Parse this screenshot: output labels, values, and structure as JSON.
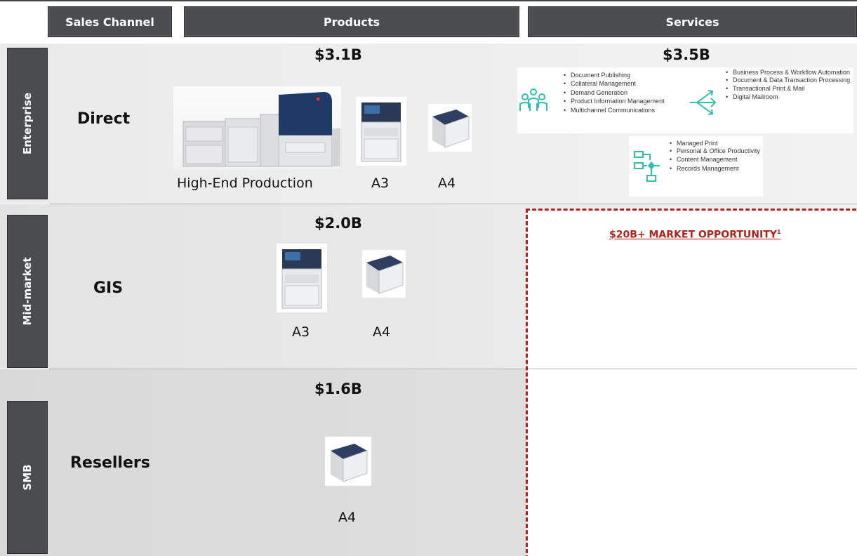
{
  "columns": {
    "sales_channel": "Sales Channel",
    "products": "Products",
    "services": "Services"
  },
  "segments": {
    "enterprise": "Enterprise",
    "mid_market": "Mid-market",
    "smb": "SMB"
  },
  "rows": {
    "enterprise": {
      "channel": "Direct",
      "products_amount": "$3.1B",
      "services_amount": "$3.5B",
      "product_labels": [
        "High-End Production",
        "A3",
        "A4"
      ]
    },
    "mid_market": {
      "channel": "GIS",
      "products_amount": "$2.0B",
      "product_labels": [
        "A3",
        "A4"
      ]
    },
    "smb": {
      "channel": "Resellers",
      "products_amount": "$1.6B",
      "product_labels": [
        "A4"
      ]
    }
  },
  "services": {
    "group1": [
      "Document Publishing",
      "Collateral Management",
      "Demand Generation",
      "Product Information Management",
      "Multichannel Communications"
    ],
    "group2": [
      "Business Process & Workflow Automation",
      "Document & Data Transaction Processing",
      "Transactional Print & Mail",
      "Digital Mailroom"
    ],
    "group3": [
      "Managed Print",
      "Personal & Office Productivity",
      "Content Management",
      "Records Management"
    ]
  },
  "opportunity": {
    "text": "$20B+ MARKET OPPORTUNITY",
    "footnote": "1"
  },
  "colors": {
    "header_bg": "#4b4c50",
    "band_bg": "#e6e6e6",
    "accent_red": "#b0231d",
    "icon_teal": "#2fbfae"
  },
  "icons": [
    "people-group-icon",
    "split-arrows-icon",
    "workflow-diagram-icon",
    "production-printer-icon",
    "a3-mfp-icon",
    "a4-printer-icon"
  ]
}
